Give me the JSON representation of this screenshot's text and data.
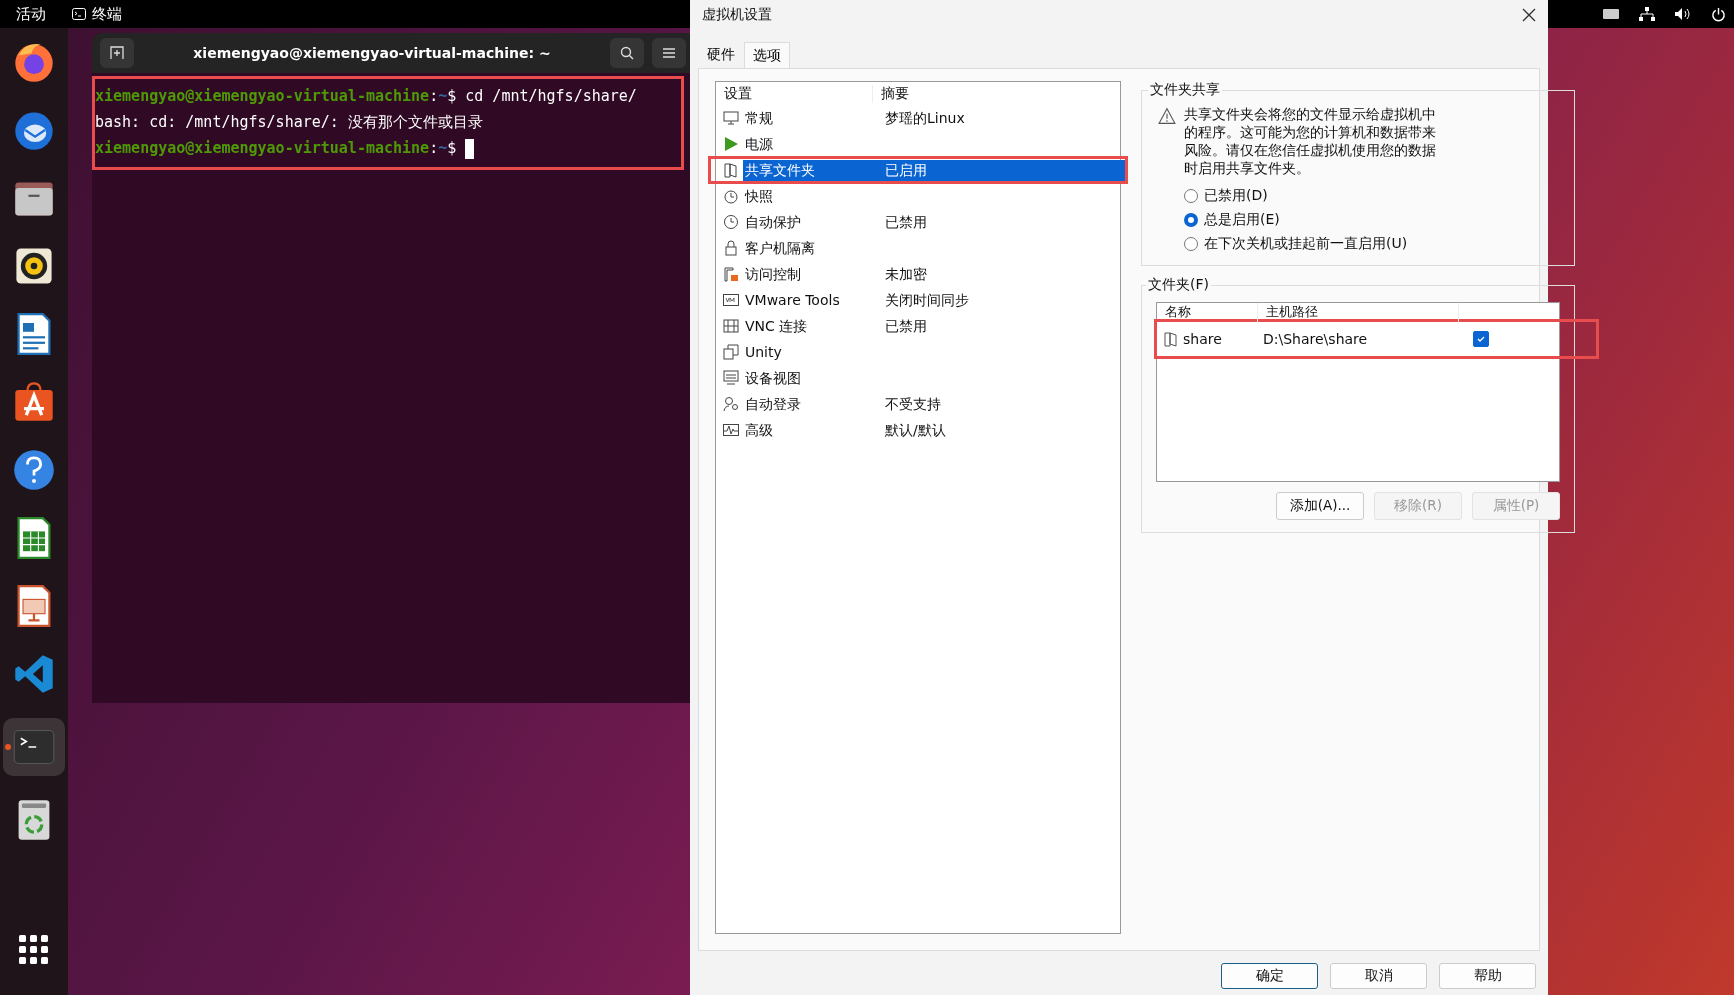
{
  "top_bar": {
    "activities": "活动",
    "app_name": "终端"
  },
  "dock": {
    "apps": [
      {
        "kind": "firefox",
        "active": false
      },
      {
        "kind": "thunderbird",
        "active": false
      },
      {
        "kind": "files",
        "active": false
      },
      {
        "kind": "rhythmbox",
        "active": false
      },
      {
        "kind": "writer",
        "active": false
      },
      {
        "kind": "software",
        "active": false
      },
      {
        "kind": "help",
        "active": false
      },
      {
        "kind": "calc",
        "active": false
      },
      {
        "kind": "impress",
        "active": false
      },
      {
        "kind": "vscode",
        "active": false
      },
      {
        "kind": "terminal",
        "active": true
      },
      {
        "kind": "trash",
        "active": false
      }
    ]
  },
  "terminal": {
    "title": "xiemengyao@xiemengyao-virtual-machine: ~",
    "highlighted": true,
    "lines": [
      {
        "kind": "prompt",
        "user": "xiemengyao@xiemengyao-virtual-machine",
        "separator": ":",
        "path": "~",
        "symbol": "$",
        "command": "cd /mnt/hgfs/share/",
        "cursor": false
      },
      {
        "kind": "output",
        "text": "bash: cd: /mnt/hgfs/share/: 没有那个文件或目录"
      },
      {
        "kind": "prompt",
        "user": "xiemengyao@xiemengyao-virtual-machine",
        "separator": ":",
        "path": "~",
        "symbol": "$",
        "cursor": true
      }
    ]
  },
  "dialog": {
    "title": "虚拟机设置",
    "tabs": [
      {
        "label": "硬件",
        "selected": false
      },
      {
        "label": "选项",
        "selected": true
      }
    ],
    "settings": {
      "columns": [
        "设置",
        "摘要"
      ],
      "rows": [
        {
          "name": "常规",
          "summary": "梦瑶的Linux",
          "selected": false,
          "highlighted": false
        },
        {
          "name": "电源",
          "summary": "",
          "selected": false,
          "highlighted": false
        },
        {
          "name": "共享文件夹",
          "summary": "已启用",
          "selected": true,
          "highlighted": true
        },
        {
          "name": "快照",
          "summary": "",
          "selected": false,
          "highlighted": false
        },
        {
          "name": "自动保护",
          "summary": "已禁用",
          "selected": false,
          "highlighted": false
        },
        {
          "name": "客户机隔离",
          "summary": "",
          "selected": false,
          "highlighted": false
        },
        {
          "name": "访问控制",
          "summary": "未加密",
          "selected": false,
          "highlighted": false
        },
        {
          "name": "VMware Tools",
          "summary": "关闭时间同步",
          "selected": false,
          "highlighted": false
        },
        {
          "name": "VNC 连接",
          "summary": "已禁用",
          "selected": false,
          "highlighted": false
        },
        {
          "name": "Unity",
          "summary": "",
          "selected": false,
          "highlighted": false
        },
        {
          "name": "设备视图",
          "summary": "",
          "selected": false,
          "highlighted": false
        },
        {
          "name": "自动登录",
          "summary": "不受支持",
          "selected": false,
          "highlighted": false
        },
        {
          "name": "高级",
          "summary": "默认/默认",
          "selected": false,
          "highlighted": false
        }
      ]
    },
    "sharing": {
      "title": "文件夹共享",
      "warning": "共享文件夹会将您的文件显示给虚拟机中的程序。这可能为您的计算机和数据带来风险。请仅在您信任虚拟机使用您的数据时启用共享文件夹。",
      "options": [
        {
          "label": "已禁用(D)",
          "selected": false
        },
        {
          "label": "总是启用(E)",
          "selected": true
        },
        {
          "label": "在下次关机或挂起前一直启用(U)",
          "selected": false
        }
      ]
    },
    "folders": {
      "title": "文件夹(F)",
      "columns": [
        "名称",
        "主机路径"
      ],
      "rows": [
        {
          "name": "share",
          "path": "D:\\Share\\share",
          "checked": true,
          "highlighted": true
        }
      ],
      "buttons": [
        {
          "label": "添加(A)...",
          "disabled": false
        },
        {
          "label": "移除(R)",
          "disabled": true
        },
        {
          "label": "属性(P)",
          "disabled": true
        }
      ]
    },
    "buttons": [
      {
        "label": "确定",
        "default": true
      },
      {
        "label": "取消",
        "default": false
      },
      {
        "label": "帮助",
        "default": false
      }
    ]
  }
}
